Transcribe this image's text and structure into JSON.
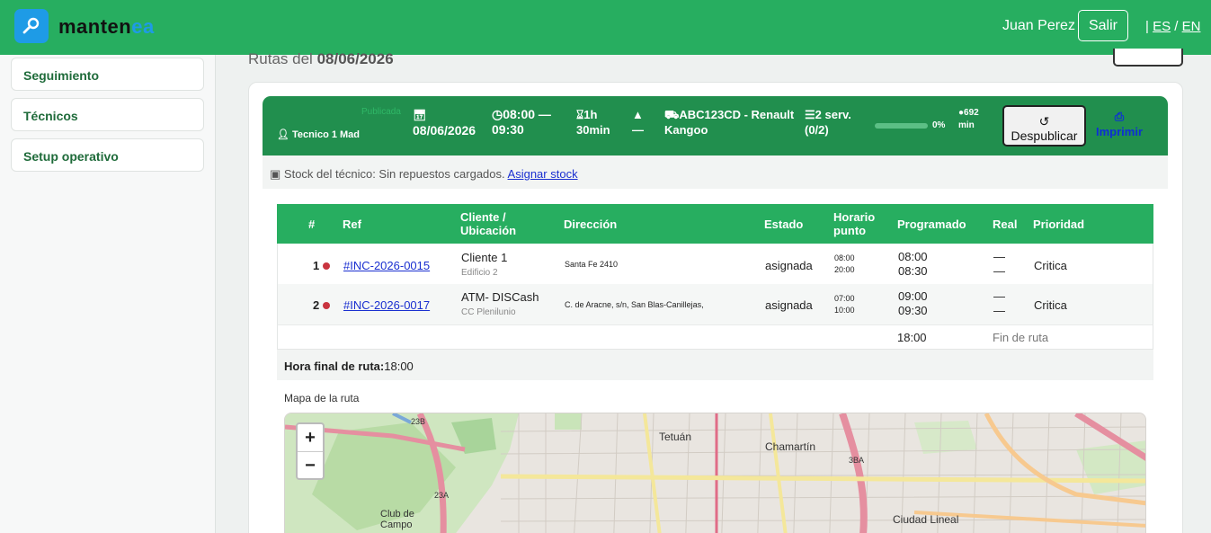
{
  "header": {
    "brand": {
      "pre": "manten",
      "post": "ea"
    },
    "user_name": "Juan Perez",
    "logout_label": "Salir",
    "lang": {
      "sep": "|",
      "es": "ES",
      "slash": "/",
      "en": "EN"
    }
  },
  "sidebar": {
    "items": [
      {
        "label": "Seguimiento"
      },
      {
        "label": "Técnicos"
      },
      {
        "label": "Setup operativo"
      }
    ]
  },
  "page": {
    "heading_prefix": "Rutas del",
    "heading_date": "08/06/2026"
  },
  "route": {
    "status": "Publicada",
    "technician": "Tecnico 1 Mad",
    "date": "08/06/2026",
    "time_start": "08:00 —",
    "time_end": "09:30",
    "duration_1": "1h",
    "duration_2": "30min",
    "distance": "—",
    "vehicle_1": "ABC123CD - Renault",
    "vehicle_2": "Kangoo",
    "services_1": "2 serv.",
    "services_2": "(0/2)",
    "progress_fraction": 0,
    "progress_label": "0%",
    "minutes_1": "692",
    "minutes_2": "min",
    "unpublish_label": "Despublicar",
    "print_label": "Imprimir"
  },
  "stock": {
    "text": "Stock del técnico: Sin repuestos cargados.",
    "link": "Asignar stock"
  },
  "table": {
    "headers": {
      "num": "#",
      "ref": "Ref",
      "client_1": "Cliente /",
      "client_2": "Ubicación",
      "address": "Dirección",
      "state": "Estado",
      "window_1": "Horario",
      "window_2": "punto",
      "scheduled": "Programado",
      "real": "Real",
      "priority": "Prioridad"
    },
    "rows": [
      {
        "num": "1",
        "ref": "#INC-2026-0015",
        "client": "Cliente 1",
        "location": "Edificio 2",
        "address": "Santa Fe 2410",
        "state": "asignada",
        "window_start": "08:00",
        "window_end": "20:00",
        "sched_start": "08:00",
        "sched_end": "08:30",
        "real_start": "—",
        "real_end": "—",
        "priority": "Critica"
      },
      {
        "num": "2",
        "ref": "#INC-2026-0017",
        "client": "ATM- DISCash",
        "location": "CC Plenilunio",
        "address": "C. de Aracne, s/n, San Blas-Canillejas,",
        "state": "asignada",
        "window_start": "07:00",
        "window_end": "10:00",
        "sched_start": "09:00",
        "sched_end": "09:30",
        "real_start": "—",
        "real_end": "—",
        "priority": "Critica"
      }
    ],
    "footer": {
      "time": "18:00",
      "label": "Fin de ruta"
    }
  },
  "final": {
    "label": "Hora final de ruta:",
    "value": "18:00"
  },
  "map": {
    "label": "Mapa de la ruta",
    "zoom_in": "+",
    "zoom_out": "−",
    "places": {
      "tetuan": "Tetuán",
      "chamartin": "Chamartín",
      "ciudad_lineal": "Ciudad Lineal",
      "club_de_campo_1": "Club de",
      "club_de_campo_2": "Campo",
      "road_23b": "23B",
      "road_23a": "23A",
      "road_3ba": "3BA"
    }
  },
  "colors": {
    "header_green": "#27ae60",
    "route_header_green": "#218f4e",
    "link_blue": "#1a2fd0",
    "priority_dot": "#c9343f"
  }
}
